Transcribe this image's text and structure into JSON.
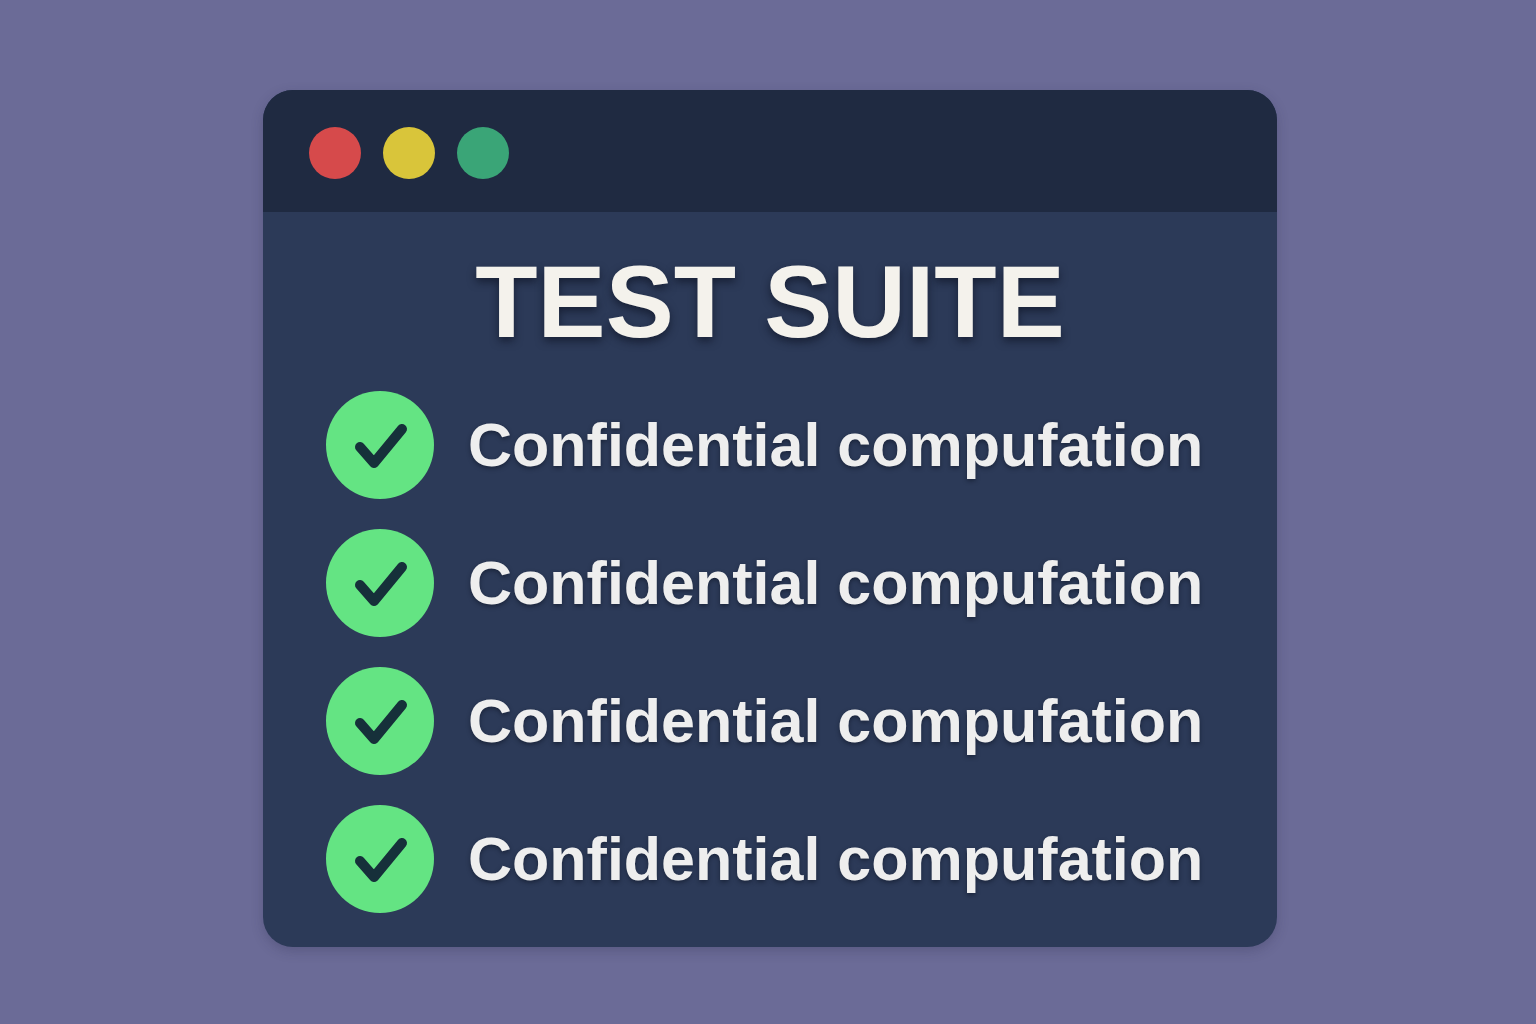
{
  "window": {
    "controls": [
      {
        "color": "#d64a4b"
      },
      {
        "color": "#d9c53a"
      },
      {
        "color": "#3aa577"
      }
    ]
  },
  "heading": "TEST SUITE",
  "tests": [
    {
      "label": "Confidential compufation",
      "passed": true
    },
    {
      "label": "Confidential compufation",
      "passed": true
    },
    {
      "label": "Confidential compufation",
      "passed": true
    },
    {
      "label": "Confidential compufation",
      "passed": true
    }
  ]
}
